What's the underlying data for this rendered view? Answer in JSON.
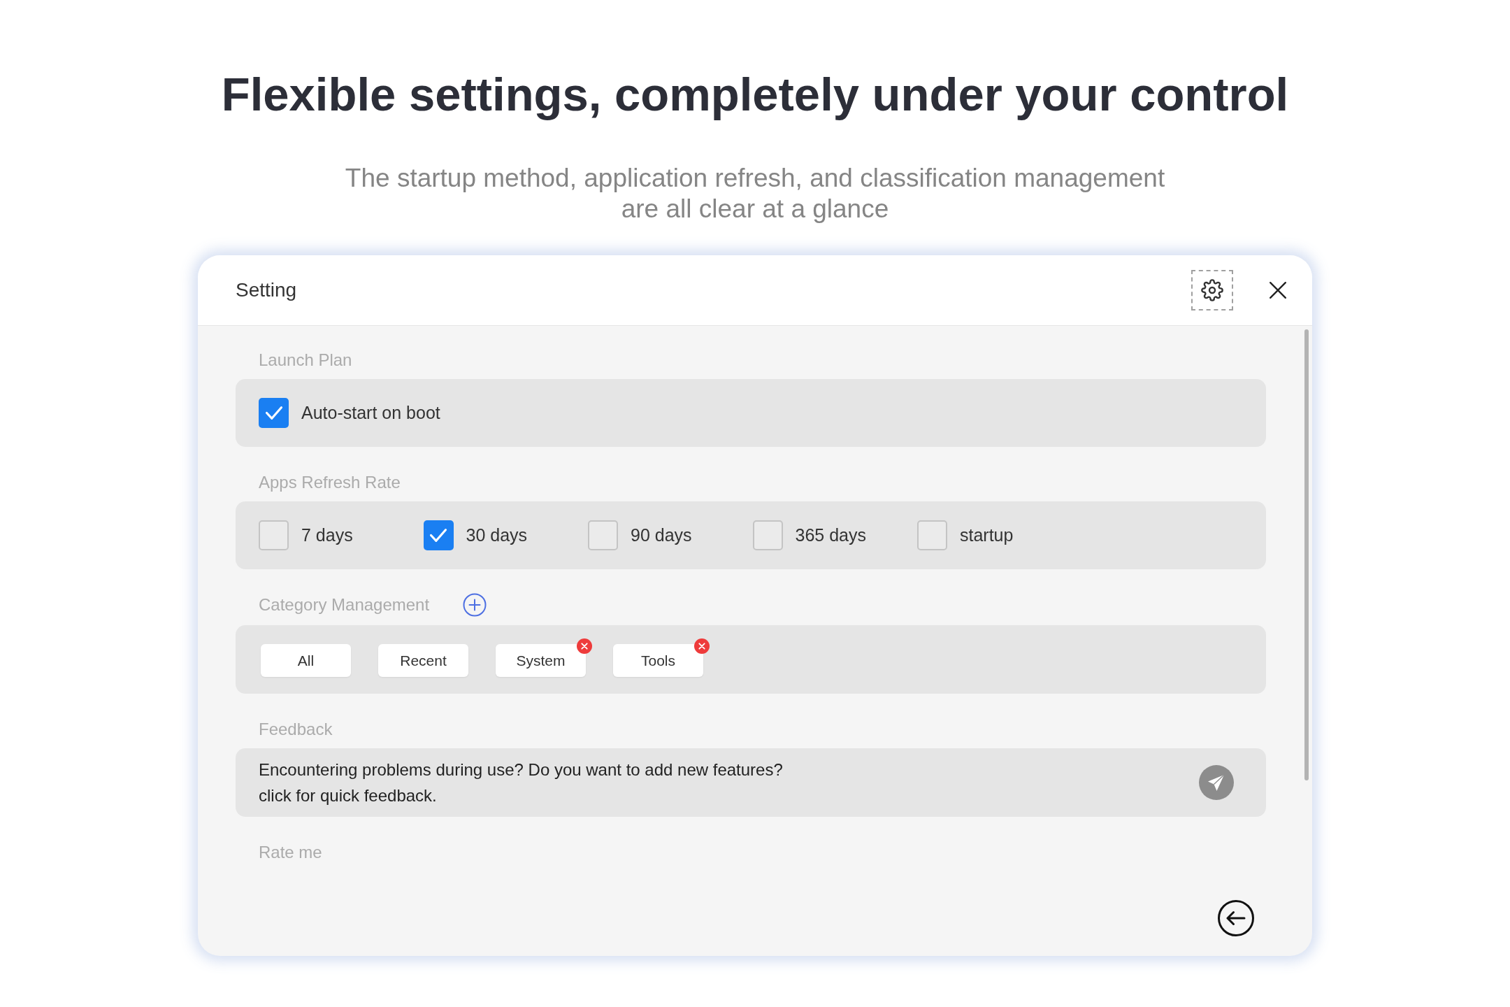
{
  "headline": "Flexible settings, completely under your control",
  "subtitle": "The startup method, application refresh, and classification management are all clear at a glance",
  "window": {
    "title": "Setting",
    "sections": [
      {
        "kind": "checkboxes",
        "label": "Launch Plan",
        "options": [
          {
            "label": "Auto-start on boot",
            "checked": true
          }
        ]
      },
      {
        "kind": "checkboxes",
        "label": "Apps Refresh Rate",
        "options": [
          {
            "label": "7 days",
            "checked": false
          },
          {
            "label": "30 days",
            "checked": true
          },
          {
            "label": "90 days",
            "checked": false
          },
          {
            "label": "365 days",
            "checked": false
          },
          {
            "label": "startup",
            "checked": false
          }
        ]
      },
      {
        "kind": "categories",
        "label": "Category Management",
        "categories": [
          {
            "label": "All",
            "removable": false
          },
          {
            "label": "Recent",
            "removable": false
          },
          {
            "label": "System",
            "removable": true
          },
          {
            "label": "Tools",
            "removable": true
          }
        ]
      },
      {
        "kind": "feedback",
        "label": "Feedback",
        "text": "Encountering problems during use? Do you want to add new features?\nclick for quick feedback."
      },
      {
        "kind": "rating",
        "label": "Rate me"
      }
    ]
  }
}
